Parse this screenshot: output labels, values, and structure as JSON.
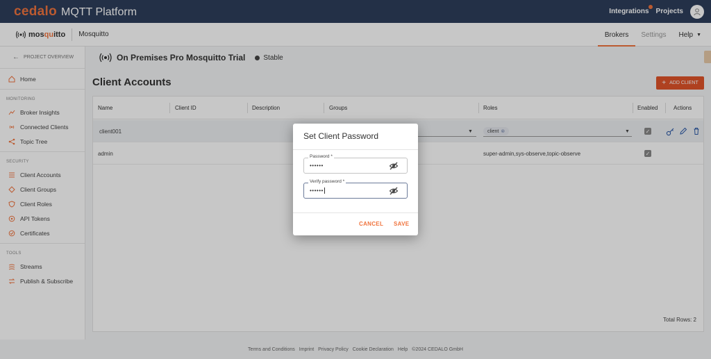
{
  "topbar": {
    "brand_logo": "cedalo",
    "brand_title": "MQTT Platform",
    "integrations": "Integrations",
    "projects": "Projects"
  },
  "subheader": {
    "logo_prefix": "mos",
    "logo_highlight": "qu",
    "logo_suffix": "itto",
    "instance_name": "Mosquitto",
    "tabs": {
      "brokers": "Brokers",
      "settings": "Settings",
      "help": "Help"
    }
  },
  "sidebar": {
    "back_label": "PROJECT OVERVIEW",
    "home": "Home",
    "sections": {
      "monitoring": "MONITORING",
      "security": "SECURITY",
      "tools": "TOOLS"
    },
    "monitoring_items": [
      "Broker Insights",
      "Connected Clients",
      "Topic Tree"
    ],
    "security_items": [
      "Client Accounts",
      "Client Groups",
      "Client Roles",
      "API Tokens",
      "Certificates"
    ],
    "tools_items": [
      "Streams",
      "Publish & Subscribe"
    ]
  },
  "broker": {
    "name": "On Premises Pro Mosquitto Trial",
    "status": "Stable"
  },
  "page": {
    "title": "Client Accounts",
    "add_button": "ADD CLIENT"
  },
  "table": {
    "headers": {
      "name": "Name",
      "client_id": "Client ID",
      "description": "Description",
      "groups": "Groups",
      "roles": "Roles",
      "enabled": "Enabled",
      "actions": "Actions"
    },
    "rows": [
      {
        "name": "client001",
        "roles": "client"
      },
      {
        "name": "admin",
        "roles": "super-admin,sys-observe,topic-observe"
      }
    ],
    "total_rows": "Total Rows: 2"
  },
  "footer": {
    "links": [
      "Terms and Conditions",
      "Imprint",
      "Privacy Policy",
      "Cookie Declaration",
      "Help"
    ],
    "copyright": "©2024 CEDALO GmbH"
  },
  "dialog": {
    "title": "Set Client Password",
    "password_label": "Password *",
    "password_value": "••••••",
    "verify_label": "Verify password *",
    "verify_value": "••••••",
    "cancel": "CANCEL",
    "save": "SAVE"
  },
  "colors": {
    "accent": "#f0743e",
    "topbar": "#2d3e5c",
    "add_button": "#e0542a"
  }
}
